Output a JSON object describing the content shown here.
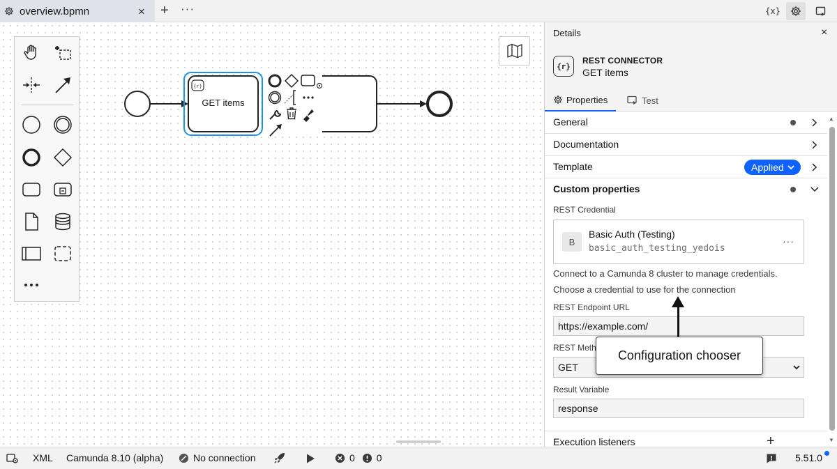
{
  "tab": {
    "filename": "overview.bpmn",
    "close_icon": "×",
    "add_icon": "+",
    "more_icon": "···"
  },
  "topbar": {
    "variables_icon": "{x}"
  },
  "canvas": {
    "task_label": "GET items"
  },
  "panel": {
    "title": "Details",
    "close_icon": "×",
    "element_icon": "{r}",
    "element_type": "REST CONNECTOR",
    "element_name": "GET items",
    "tabs": [
      "Properties",
      "Test"
    ],
    "groups": {
      "general": "General",
      "documentation": "Documentation",
      "template": "Template",
      "template_badge": "Applied",
      "custom": "Custom properties",
      "execution": "Execution listeners"
    },
    "rest_credential_label": "REST Credential",
    "credential": {
      "avatar": "B",
      "name": "Basic Auth (Testing)",
      "id": "basic_auth_testing_yedois",
      "more": "···"
    },
    "help_connect": "Connect to a Camunda 8 cluster to manage credentials.",
    "help_choose": "Choose a credential to use for the connection",
    "endpoint_label": "REST Endpoint URL",
    "endpoint_value": "https://example.com/",
    "method_label": "REST Meth",
    "method_value": "GET",
    "result_label": "Result Variable",
    "result_value": "response",
    "exec_add_icon": "+"
  },
  "callout": {
    "text": "Configuration chooser"
  },
  "statusbar": {
    "xml": "XML",
    "engine": "Camunda 8.10 (alpha)",
    "connection": "No connection",
    "errors": "0",
    "warnings": "0",
    "version": "5.51.0"
  },
  "colors": {
    "accent": "#0f62fe",
    "selection": "#1a96e8"
  }
}
